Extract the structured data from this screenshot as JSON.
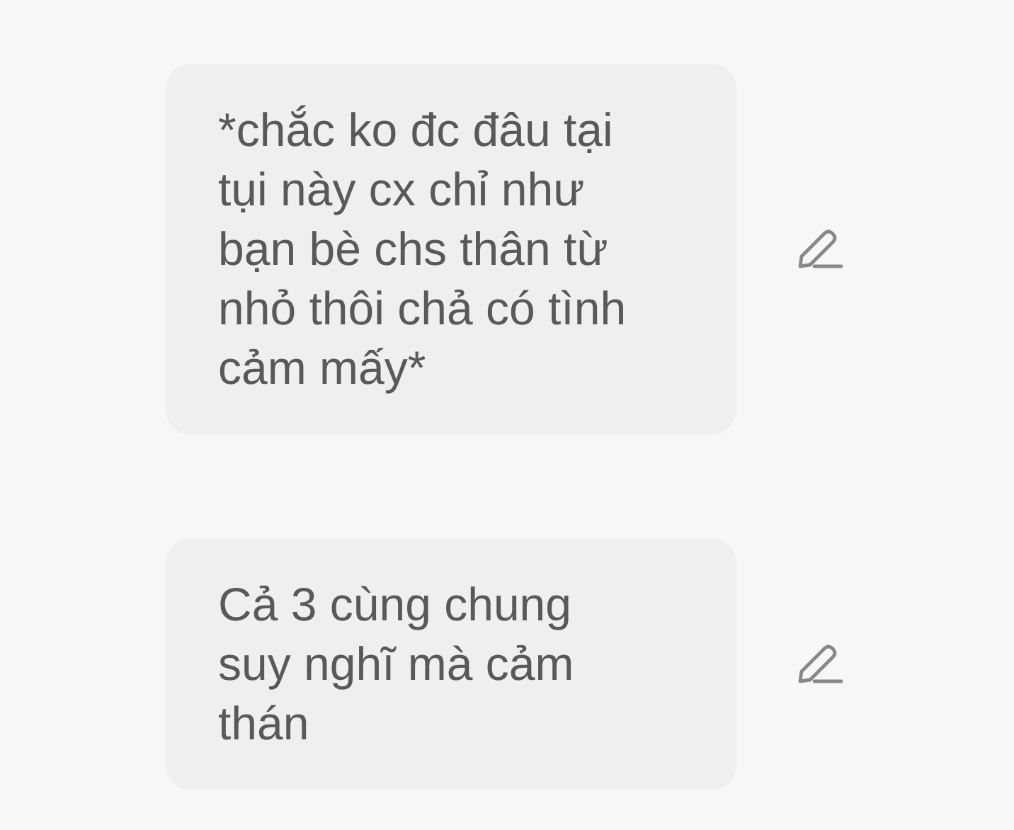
{
  "messages": [
    {
      "text": "*chắc ko đc đâu tại\ntụi này cx chỉ như\nbạn bè chs thân từ\nnhỏ thôi chả có tình\ncảm mấy*"
    },
    {
      "text": "Cả 3 cùng chung\nsuy nghĩ mà cảm\nthán"
    }
  ]
}
